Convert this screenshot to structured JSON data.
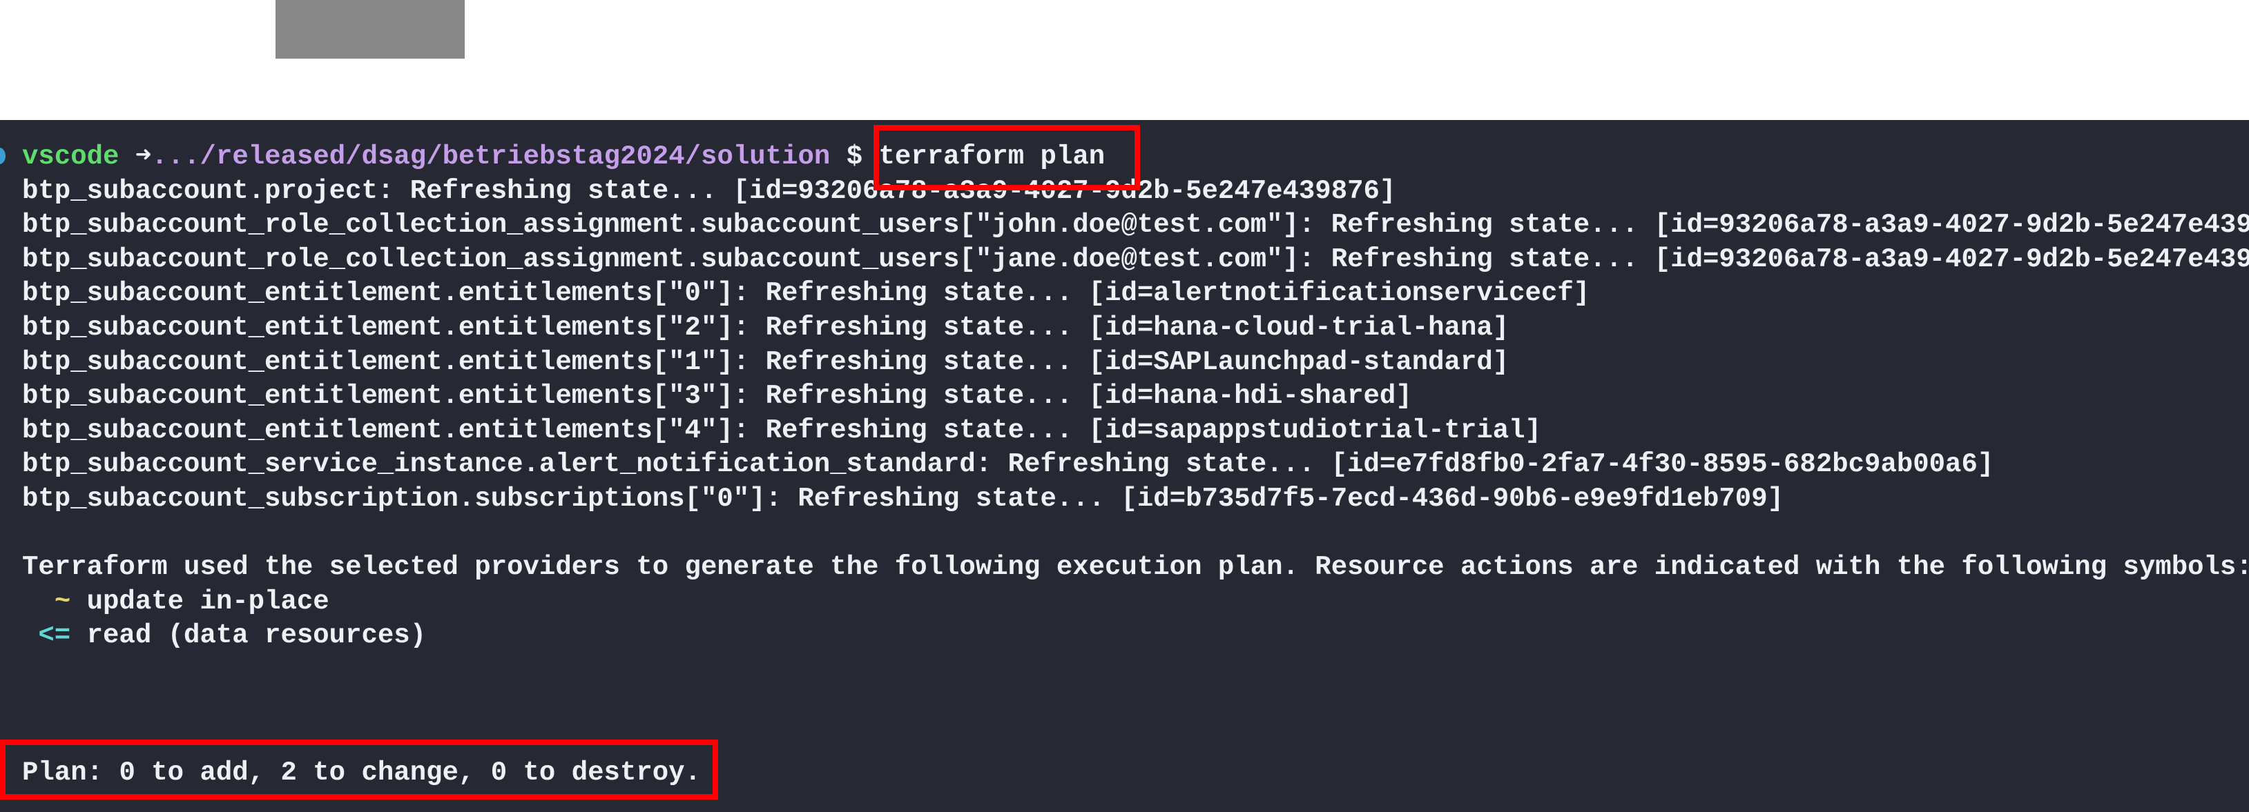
{
  "prompt": {
    "user": "vscode",
    "arrow": "➜",
    "path": ".../released/dsag/betriebstag2024/solution",
    "symbol": "$",
    "command": "terraform plan"
  },
  "refresh_lines": [
    "btp_subaccount.project: Refreshing state... [id=93206a78-a3a9-4027-9d2b-5e247e439876]",
    "btp_subaccount_role_collection_assignment.subaccount_users[\"john.doe@test.com\"]: Refreshing state... [id=93206a78-a3a9-4027-9d2b-5e247e439",
    "btp_subaccount_role_collection_assignment.subaccount_users[\"jane.doe@test.com\"]: Refreshing state... [id=93206a78-a3a9-4027-9d2b-5e247e439",
    "btp_subaccount_entitlement.entitlements[\"0\"]: Refreshing state... [id=alertnotificationservicecf]",
    "btp_subaccount_entitlement.entitlements[\"2\"]: Refreshing state... [id=hana-cloud-trial-hana]",
    "btp_subaccount_entitlement.entitlements[\"1\"]: Refreshing state... [id=SAPLaunchpad-standard]",
    "btp_subaccount_entitlement.entitlements[\"3\"]: Refreshing state... [id=hana-hdi-shared]",
    "btp_subaccount_entitlement.entitlements[\"4\"]: Refreshing state... [id=sapappstudiotrial-trial]",
    "btp_subaccount_service_instance.alert_notification_standard: Refreshing state... [id=e7fd8fb0-2fa7-4f30-8595-682bc9ab00a6]",
    "btp_subaccount_subscription.subscriptions[\"0\"]: Refreshing state... [id=b735d7f5-7ecd-436d-90b6-e9e9fd1eb709]"
  ],
  "plan_intro": "Terraform used the selected providers to generate the following execution plan. Resource actions are indicated with the following symbols:",
  "symbols": [
    {
      "symbol": "~",
      "label": "update in-place",
      "color": "#e6d36a"
    },
    {
      "symbol": "<=",
      "label": "read (data resources)",
      "color": "#5fd7d7"
    }
  ],
  "summary": {
    "label": "Plan:",
    "text": "0 to add, 2 to change, 0 to destroy."
  },
  "colors": {
    "background": "#262834",
    "highlight": "#ff0000"
  }
}
